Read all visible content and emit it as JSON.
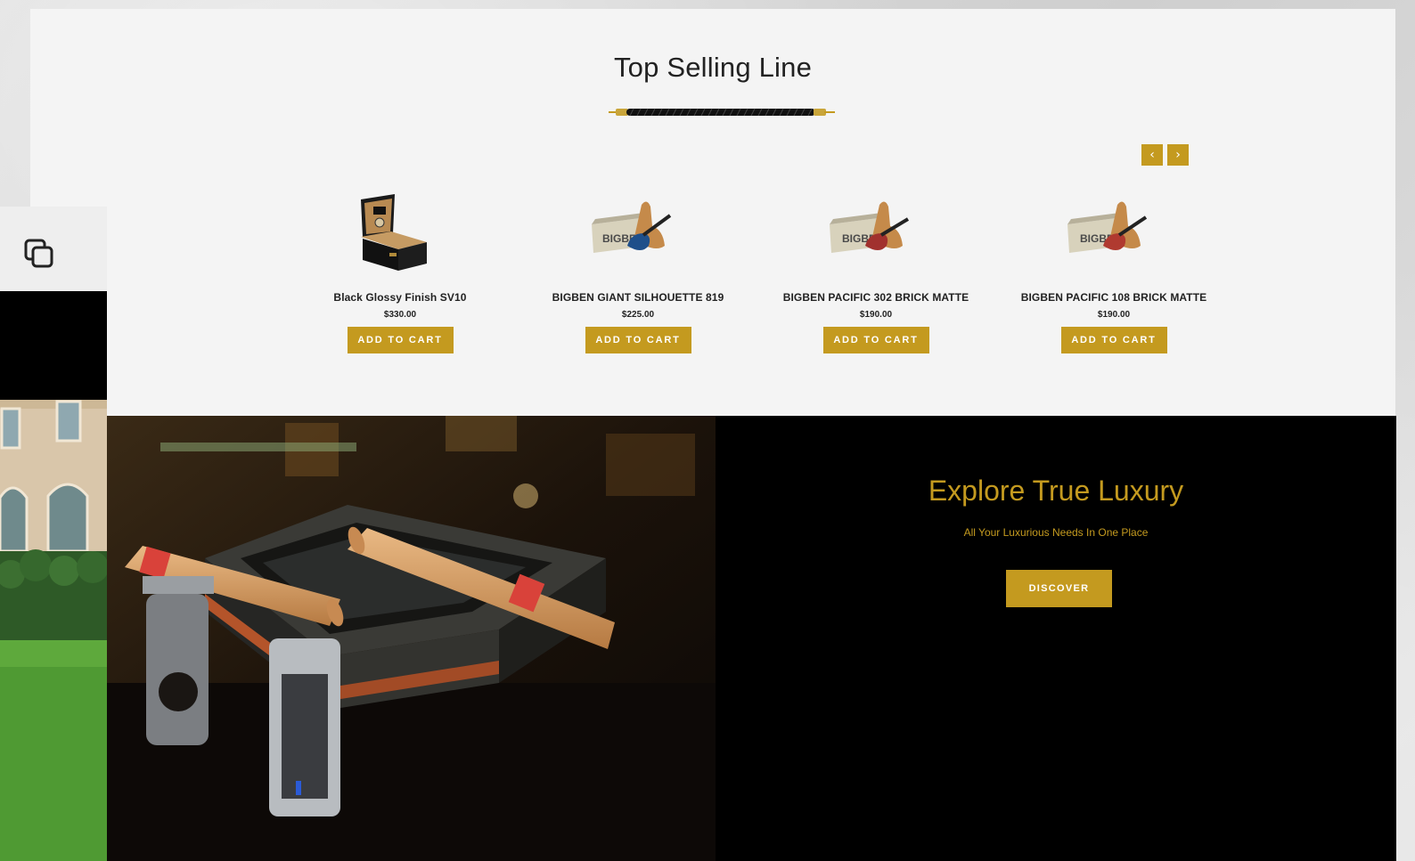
{
  "top_selling": {
    "title": "Top Selling Line",
    "prev_arrow": "‹",
    "next_arrow": "›",
    "products": [
      {
        "name": "Black Glossy Finish SV10",
        "price": "$330.00",
        "button": "ADD TO CART",
        "image": "humidor-image"
      },
      {
        "name": "BIGBEN GIANT SILHOUETTE 819",
        "price": "$225.00",
        "button": "ADD TO CART",
        "image": "pipe-box-image"
      },
      {
        "name": "BIGBEN PACIFIC 302 BRICK MATTE",
        "price": "$190.00",
        "button": "ADD TO CART",
        "image": "pipe-box-image"
      },
      {
        "name": "BIGBEN PACIFIC 108 BRICK MATTE",
        "price": "$190.00",
        "button": "ADD TO CART",
        "image": "pipe-box-image"
      }
    ]
  },
  "pipe_box_label": "BIGBEN",
  "side_widget": {
    "icon": "copy-icon"
  },
  "banner": {
    "title": "Explore True Luxury",
    "subtitle": "All Your Luxurious Needs In One Place",
    "button": "DISCOVER",
    "image": "cigar-ashtray-photo"
  },
  "colors": {
    "accent": "#c49a1f",
    "panel_bg": "#f4f4f4",
    "banner_bg": "#000000"
  }
}
